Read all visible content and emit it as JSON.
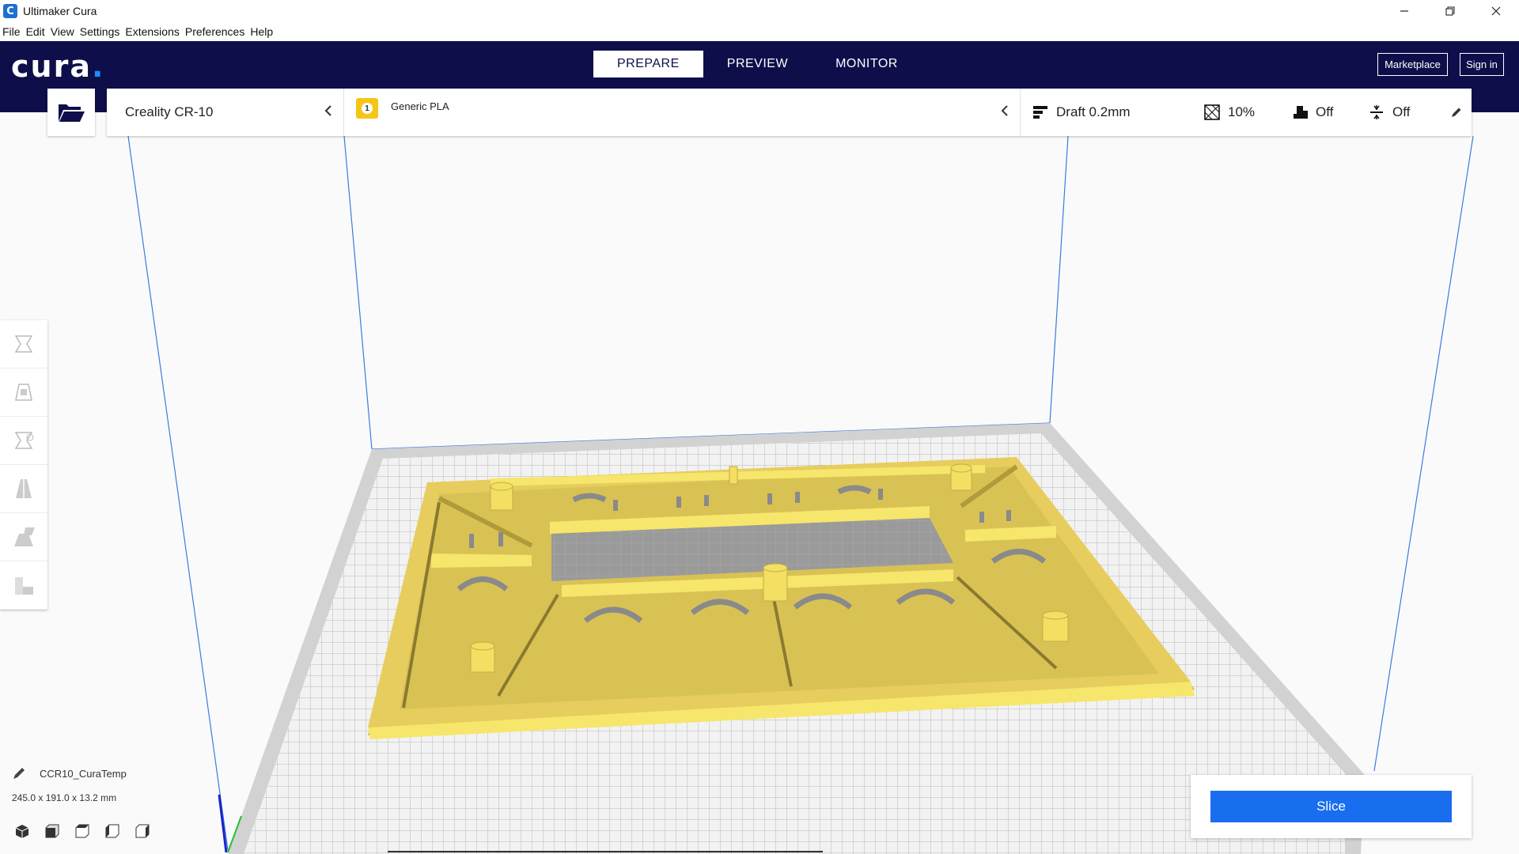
{
  "window": {
    "title": "Ultimaker Cura",
    "app_icon": "cura-c-icon",
    "controls": [
      "minimize-icon",
      "restore-icon",
      "close-icon"
    ]
  },
  "menu": [
    {
      "label": "File"
    },
    {
      "label": "Edit"
    },
    {
      "label": "View"
    },
    {
      "label": "Settings"
    },
    {
      "label": "Extensions"
    },
    {
      "label": "Preferences"
    },
    {
      "label": "Help"
    }
  ],
  "header": {
    "logo": "cura",
    "logo_dot": ".",
    "tabs": [
      {
        "label": "PREPARE",
        "active": true
      },
      {
        "label": "PREVIEW",
        "active": false
      },
      {
        "label": "MONITOR",
        "active": false
      }
    ],
    "marketplace_label": "Marketplace",
    "signin_label": "Sign in"
  },
  "toolbar": {
    "printer": "Creality CR-10",
    "extruder_number": "1",
    "material": "Generic PLA",
    "profile": "Draft 0.2mm",
    "infill": "10%",
    "support": "Off",
    "adhesion": "Off"
  },
  "object": {
    "name": "CCR10_CuraTemp",
    "dimensions": "245.0 x 191.0 x 13.2 mm"
  },
  "slice": {
    "label": "Slice"
  },
  "colors": {
    "header_bg": "#0e0f4a",
    "accent": "#196ef0",
    "model_yellow": "#f5e063",
    "build_plate": "#dcdcdc"
  }
}
